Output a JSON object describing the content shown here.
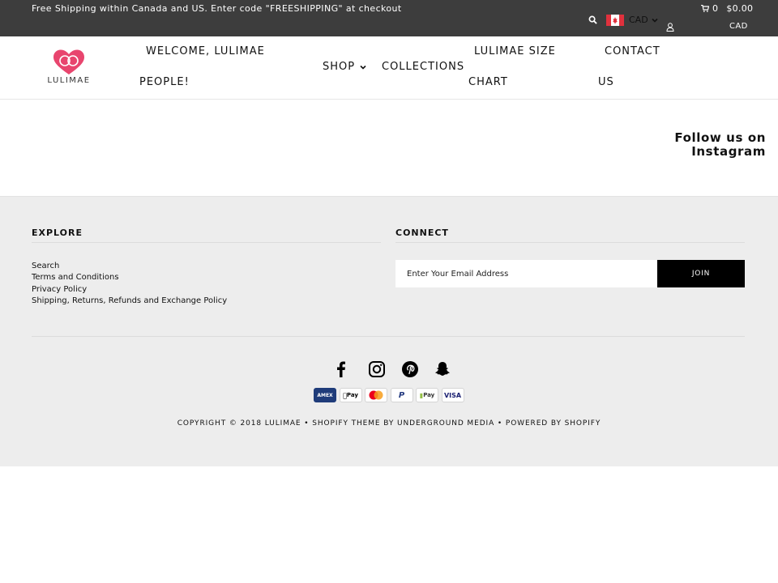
{
  "topbar": {
    "promo": "Free Shipping within Canada and US. Enter code \"FREESHIPPING\" at checkout",
    "currency": "CAD",
    "cart_count": "0",
    "cart_total": "$0.00",
    "cart_currency": "CAD",
    "icons": [
      "search-icon",
      "canada-flag-icon",
      "chevron-down-icon",
      "account-icon",
      "cart-icon"
    ]
  },
  "header": {
    "logo_text": "LULIMAE",
    "nav": {
      "welcome_line1": "WELCOME, LULIMAE",
      "welcome_line2": "PEOPLE!",
      "shop": "SHOP",
      "collections": "COLLECTIONS",
      "size_line1": "LULIMAE SIZE",
      "size_line2": "CHART",
      "contact_line1": "CONTACT",
      "contact_line2": "US"
    }
  },
  "main": {
    "instagram_line1": "Follow us on",
    "instagram_line2": "Instagram"
  },
  "footer": {
    "explore": {
      "heading": "EXPLORE",
      "links": [
        "Search",
        "Terms and Conditions",
        "Privacy Policy",
        "Shipping, Returns, Refunds and Exchange Policy"
      ]
    },
    "connect": {
      "heading": "CONNECT",
      "email_placeholder": "Enter Your Email Address",
      "join_label": "JOIN"
    },
    "social_icons": [
      "facebook-icon",
      "instagram-icon",
      "pinterest-icon",
      "snapchat-icon"
    ],
    "payments": {
      "amex": "AMEX",
      "apple_pay": "Pay",
      "paypal": "P",
      "shopify_pay": "Pay",
      "visa": "VISA"
    },
    "copyright": "COPYRIGHT © 2018 LULIMAE • SHOPIFY THEME BY UNDERGROUND MEDIA •  POWERED BY SHOPIFY"
  },
  "colors": {
    "topbar_bg": "#3d3d3d",
    "footer_bg": "#ededed",
    "logo_pink": "#e8456e",
    "join_bg": "#000000"
  }
}
